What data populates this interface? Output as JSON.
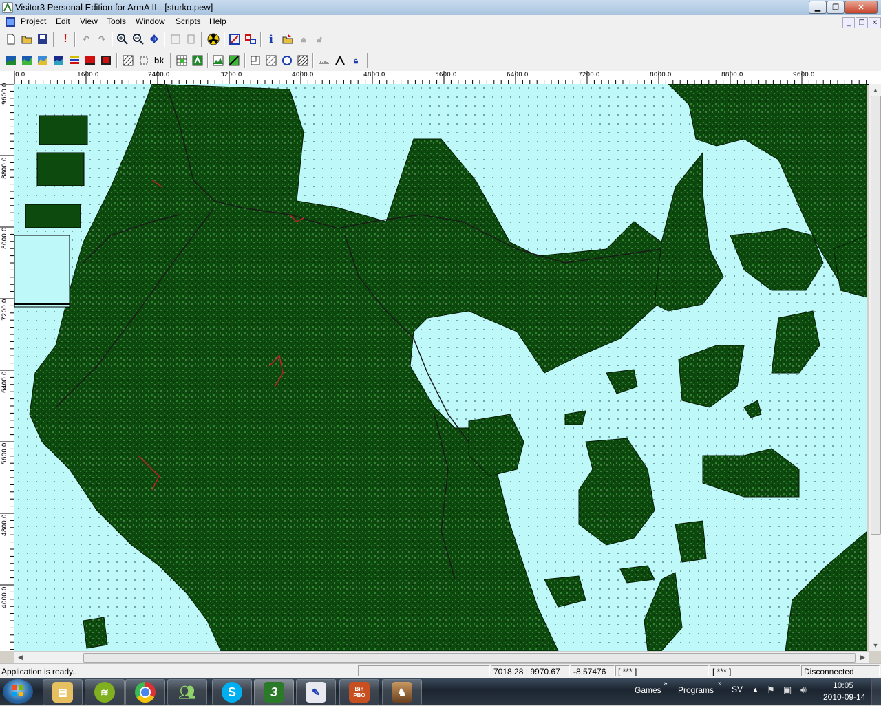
{
  "window": {
    "title": "Visitor3 Personal Edition for ArmA II - [sturko.pew]"
  },
  "menu": [
    "Project",
    "Edit",
    "View",
    "Tools",
    "Window",
    "Scripts",
    "Help"
  ],
  "toolbar1": {
    "buttons": [
      "new-icon",
      "open-icon",
      "save-icon",
      "warning-icon",
      "undo-icon",
      "redo-icon",
      "zoom-in-icon",
      "zoom-out-icon",
      "center-icon",
      "page-icon",
      "page-edit-icon",
      "radiation-icon",
      "select-icon",
      "link-icon",
      "info-icon",
      "import-icon",
      "lock-icon",
      "unlock-icon"
    ]
  },
  "toolbar2": {
    "bk_label": "bk",
    "buttons": [
      "layer1-icon",
      "layer2-icon",
      "layer3-icon",
      "layer4-icon",
      "stripes-icon",
      "red-layer-icon",
      "red-layer2-icon",
      "hatch-icon",
      "dotted-rect-icon",
      "bk-icon",
      "grid-icon",
      "grid-green-icon",
      "terrain-icon",
      "terrain2-icon",
      "rect-icon",
      "hatch2-icon",
      "circle-icon",
      "hatch3-icon",
      "measure-icon",
      "peak-icon",
      "lock2-icon"
    ]
  },
  "ruler": {
    "h_labels": [
      "0.0",
      "1600.0",
      "2400.0",
      "3200.0",
      "4000.0",
      "4800.0",
      "5600.0",
      "6400.0",
      "7200.0",
      "8000.0",
      "8800.0",
      "9600.0"
    ],
    "v_labels": [
      "9600.0",
      "8800.0",
      "8000.0",
      "7200.0",
      "6400.0",
      "5600.0",
      "4800.0",
      "4000.0"
    ]
  },
  "colors": {
    "land": "#0d4a0d",
    "water": "#bff8f8",
    "road": "#1a1a1a",
    "accent_red": "#c0202a"
  },
  "status": {
    "message": "Application is ready...",
    "coords": "7018.28 : 9970.67",
    "height": "-8.57476",
    "field1": "[ *** ]",
    "field2": "[ *** ]",
    "connection": "Disconnected"
  },
  "taskbar": {
    "apps": [
      "explorer-icon",
      "spotify-icon",
      "chrome-icon",
      "messenger-icon",
      "skype-icon",
      "visitor3-icon",
      "draw-icon",
      "binpbo-icon",
      "game-icon"
    ],
    "binpbo_label": "Bin PBO",
    "visitor_label": "3",
    "toolbars": [
      "Games",
      "Programs"
    ],
    "lang": "SV",
    "time": "10:05",
    "date": "2010-09-14"
  }
}
